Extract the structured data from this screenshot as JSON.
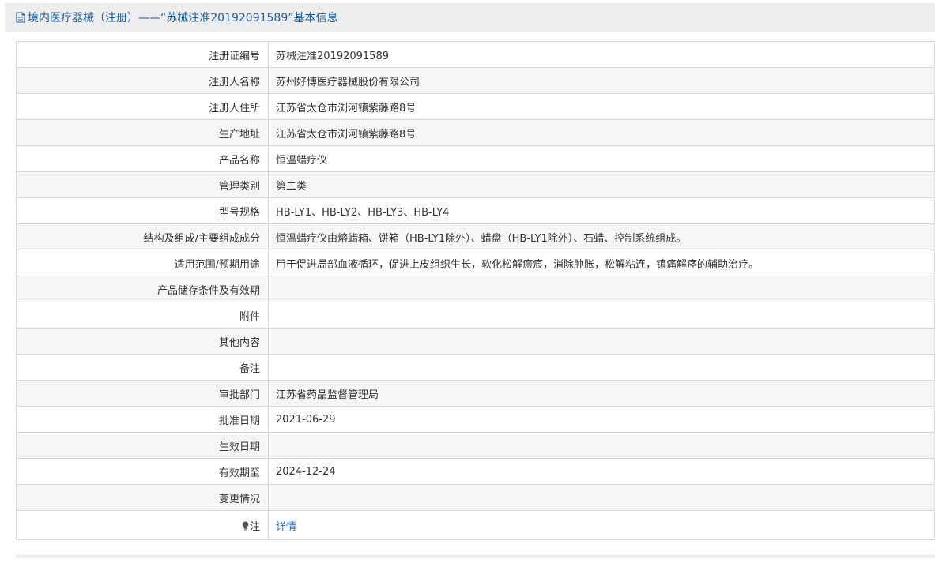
{
  "header": {
    "title": "境内医疗器械（注册）——“苏械注准20192091589”基本信息",
    "icon": "document-icon",
    "title_color": "#1a5ea8"
  },
  "fields": [
    {
      "label": "注册证编号",
      "value": "苏械注准20192091589"
    },
    {
      "label": "注册人名称",
      "value": "苏州好博医疗器械股份有限公司"
    },
    {
      "label": "注册人住所",
      "value": "江苏省太仓市浏河镇紫藤路8号"
    },
    {
      "label": "生产地址",
      "value": "江苏省太仓市浏河镇紫藤路8号"
    },
    {
      "label": "产品名称",
      "value": "恒温蜡疗仪"
    },
    {
      "label": "管理类别",
      "value": "第二类"
    },
    {
      "label": "型号规格",
      "value": "HB-LY1、HB-LY2、HB-LY3、HB-LY4"
    },
    {
      "label": "结构及组成/主要组成成分",
      "value": "恒温蜡疗仪由熔蜡箱、饼箱（HB-LY1除外）、蜡盘（HB-LY1除外）、石蜡、控制系统组成。"
    },
    {
      "label": "适用范围/预期用途",
      "value": "用于促进局部血液循环，促进上皮组织生长，软化松解瘢痕，消除肿胀，松解粘连，镇痛解痉的辅助治疗。"
    },
    {
      "label": "产品储存条件及有效期",
      "value": ""
    },
    {
      "label": "附件",
      "value": ""
    },
    {
      "label": "其他内容",
      "value": ""
    },
    {
      "label": "备注",
      "value": ""
    },
    {
      "label": "审批部门",
      "value": "江苏省药品监督管理局"
    },
    {
      "label": "批准日期",
      "value": "2021-06-29"
    },
    {
      "label": "生效日期",
      "value": ""
    },
    {
      "label": "有效期至",
      "value": "2024-12-24"
    },
    {
      "label": "变更情况",
      "value": ""
    }
  ],
  "note": {
    "icon": "lightbulb-icon",
    "label": "注",
    "link_text": "详情",
    "link_color": "#2a6fc0"
  }
}
